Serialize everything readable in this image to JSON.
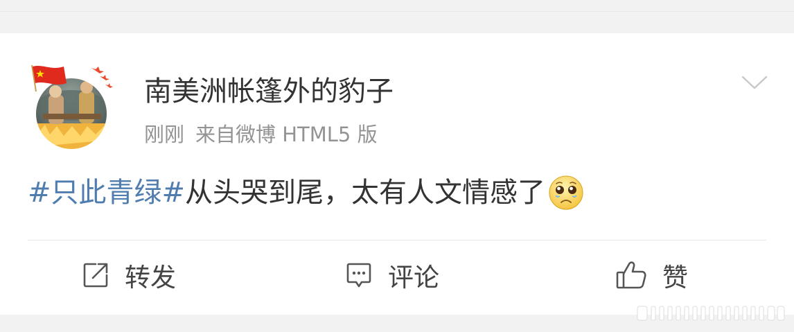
{
  "post": {
    "username": "南美洲帐篷外的豹子",
    "time": "刚刚",
    "source": "来自微博 HTML5 版",
    "hashtag": "#只此青绿#",
    "text": "从头哭到尾，太有人文情感了",
    "emoji": "crying-face-icon"
  },
  "actions": {
    "repost_label": "转发",
    "comment_label": "评论",
    "like_label": "赞"
  },
  "colors": {
    "hashtag": "#507daf",
    "text": "#333333",
    "meta": "#939393",
    "background": "#f2f2f2"
  }
}
